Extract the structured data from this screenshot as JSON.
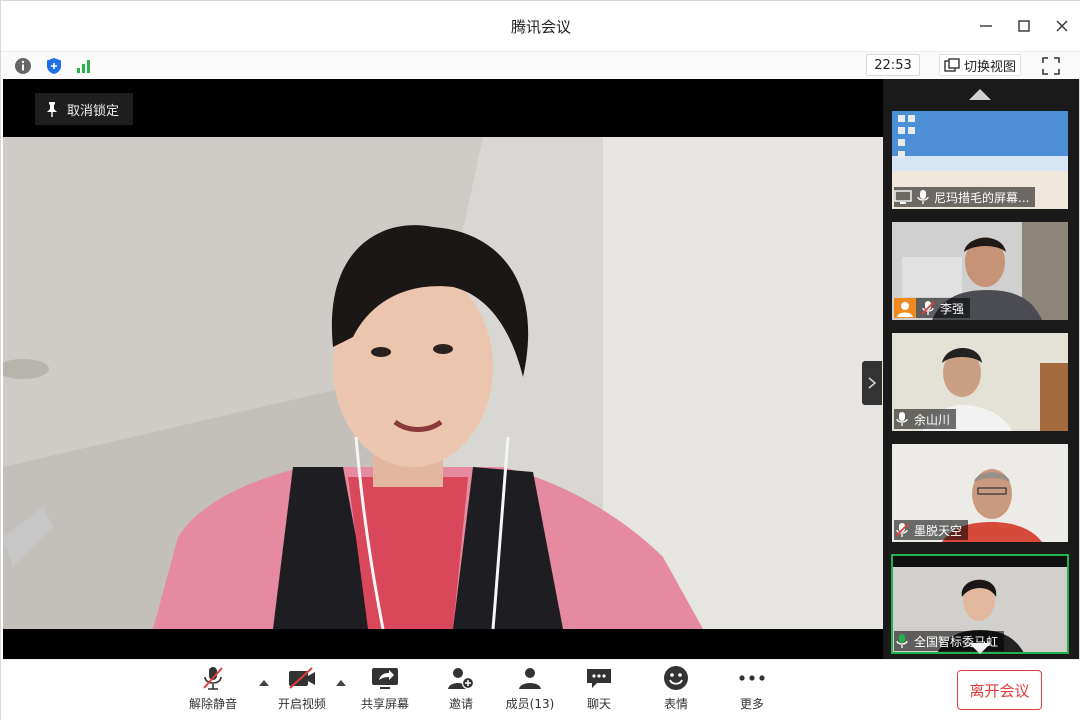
{
  "window": {
    "title": "腾讯会议"
  },
  "status": {
    "time": "22:53",
    "switch_view_label": "切换视图"
  },
  "stage": {
    "unpin_label": "取消锁定"
  },
  "participants": [
    {
      "name": "尼玛措毛的屏幕...",
      "mic": "on",
      "screen_share": true
    },
    {
      "name": "李强",
      "mic": "off",
      "avatar_badge": true
    },
    {
      "name": "余山川",
      "mic": "on"
    },
    {
      "name": "墨脱天空",
      "mic": "off"
    },
    {
      "name": "全国智标委马虹",
      "mic": "on",
      "active": true
    }
  ],
  "toolbar": {
    "unmute_label": "解除静音",
    "start_video_label": "开启视频",
    "share_screen_label": "共享屏幕",
    "invite_label": "邀请",
    "members_label": "成员(13)",
    "chat_label": "聊天",
    "emoji_label": "表情",
    "more_label": "更多",
    "leave_label": "离开会议"
  },
  "colors": {
    "leave_red": "#e23c3c",
    "active_green": "#22b14c",
    "shield_blue": "#1e6fe8",
    "signal_green": "#2bb24c"
  }
}
